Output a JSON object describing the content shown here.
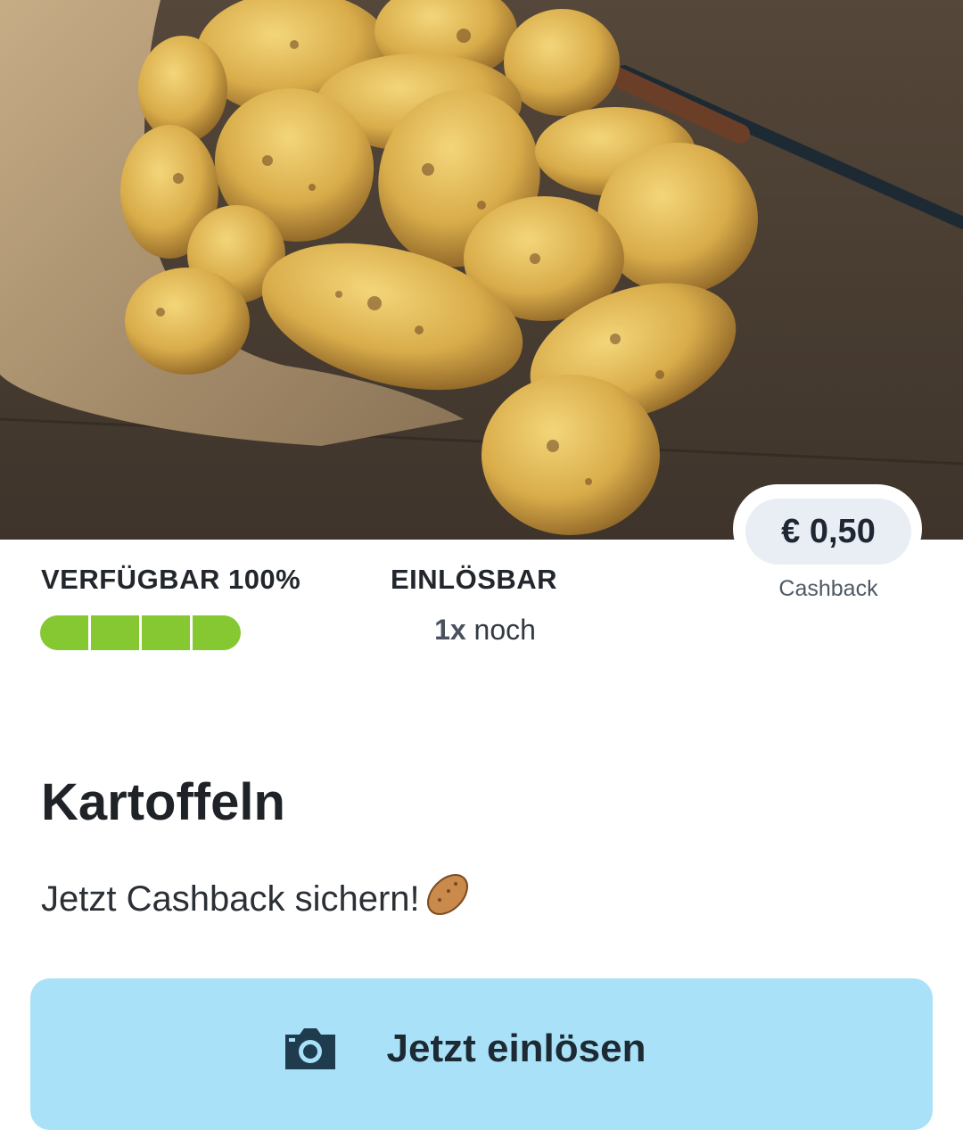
{
  "hero": {
    "image": "potatoes-in-burlap-sack-photo"
  },
  "cashback": {
    "amount": "€ 0,50",
    "label": "Cashback"
  },
  "availability": {
    "title": "VERFÜGBAR 100%",
    "percent": 100,
    "segments": 4
  },
  "redeemable": {
    "title": "EINLÖSBAR",
    "count": "1x",
    "suffix": " noch"
  },
  "product": {
    "title": "Kartoffeln",
    "subtitle": "Jetzt Cashback sichern!"
  },
  "cta": {
    "label": "Jetzt einlösen",
    "icon": "camera-icon"
  },
  "colors": {
    "accent_bar": "#86c832",
    "cta_bg": "#a9e2f8",
    "pill_bg": "#e9eef5"
  }
}
